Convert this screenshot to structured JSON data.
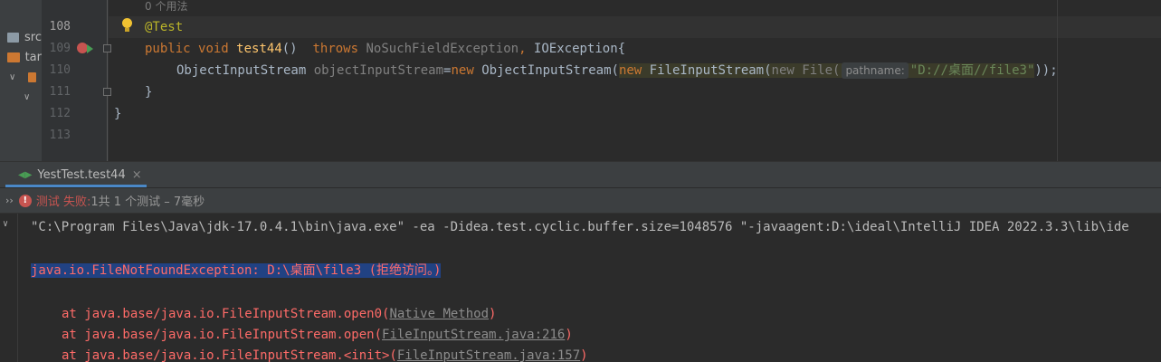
{
  "project": {
    "rows": [
      "src",
      "tar",
      ""
    ]
  },
  "editor": {
    "usages_hint": "0 个用法",
    "line_numbers": [
      "108",
      "109",
      "110",
      "111",
      "112",
      "113"
    ],
    "lines": {
      "l108": {
        "annotation": "@Test"
      },
      "l109": {
        "kw_public": "public",
        "kw_void": "void",
        "method": "test44",
        "params": "()",
        "kw_throws": "throws",
        "exc1": "NoSuchFieldException",
        "comma": ", ",
        "exc2": "IOException",
        "brace": "{"
      },
      "l110": {
        "type1": "ObjectInputStream",
        "var": "objectInputStream",
        "eq": "=",
        "kw_new1": "new",
        "type2": "ObjectInputStream",
        "paren1": "(",
        "kw_new2": "new",
        "type3": "FileInputStream",
        "paren2": "(",
        "kw_new3": "new",
        "type4": "File",
        "paren3": "(",
        "param_hint": "pathname:",
        "str": "\"D://桌面//file3\"",
        "close": "));"
      },
      "l111": {
        "brace": "}"
      },
      "l112": {
        "brace": "}"
      }
    }
  },
  "run": {
    "tab_label": "YestTest.test44",
    "status_label": "测试 失败:",
    "status_detail": "1共 1 个测试 – 7毫秒"
  },
  "console": {
    "cmd": "\"C:\\Program Files\\Java\\jdk-17.0.4.1\\bin\\java.exe\" -ea -Didea.test.cyclic.buffer.size=1048576 \"-javaagent:D:\\ideal\\IntelliJ IDEA 2022.3.3\\lib\\ide",
    "exception": "java.io.FileNotFoundException: D:\\桌面\\file3 (拒绝访问。)",
    "stack": [
      {
        "prefix": "at java.base/java.io.FileInputStream.open0(",
        "link": "Native Method",
        "suffix": ")"
      },
      {
        "prefix": "at java.base/java.io.FileInputStream.open(",
        "link": "FileInputStream.java:216",
        "suffix": ")"
      },
      {
        "prefix": "at java.base/java.io.FileInputStream.<init>(",
        "link": "FileInputStream.java:157",
        "suffix": ")"
      }
    ]
  },
  "colors": {
    "background": "#2b2b2b",
    "keyword": "#cc7832",
    "annotation": "#bbb529",
    "method": "#ffc66d",
    "string": "#6a8759",
    "error": "#ff6b68",
    "selection": "#214283",
    "fail": "#c75450"
  }
}
